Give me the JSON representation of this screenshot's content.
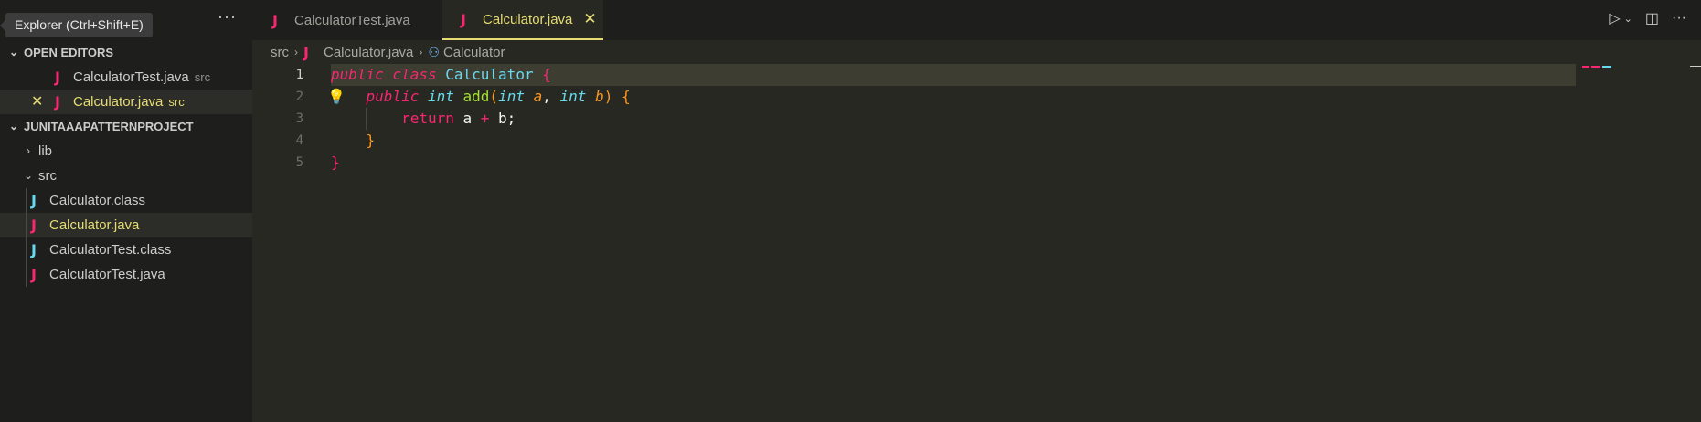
{
  "sidebar": {
    "tooltip": "Explorer (Ctrl+Shift+E)",
    "more_label": "···",
    "open_editors": {
      "title": "OPEN EDITORS",
      "items": [
        {
          "name": "CalculatorTest.java",
          "desc": "src"
        },
        {
          "name": "Calculator.java",
          "desc": "src"
        }
      ]
    },
    "project": {
      "title": "JUNITAAAPATTERNPROJECT",
      "folders": [
        {
          "name": "lib"
        },
        {
          "name": "src"
        }
      ],
      "files": [
        {
          "name": "Calculator.class",
          "icon": "java-icon-blue"
        },
        {
          "name": "Calculator.java",
          "icon": "java-icon-red"
        },
        {
          "name": "CalculatorTest.class",
          "icon": "java-icon-blue"
        },
        {
          "name": "CalculatorTest.java",
          "icon": "java-icon-red"
        }
      ]
    }
  },
  "tabs": [
    {
      "label": "CalculatorTest.java"
    },
    {
      "label": "Calculator.java"
    }
  ],
  "breadcrumb": {
    "folder": "src",
    "file": "Calculator.java",
    "symbol": "Calculator"
  },
  "editor": {
    "line_numbers": [
      "1",
      "2",
      "3",
      "4",
      "5"
    ]
  },
  "colors": {
    "accent": "#e6db74",
    "java_red": "#f92672",
    "java_blue": "#66d9ef",
    "background": "#272822"
  }
}
